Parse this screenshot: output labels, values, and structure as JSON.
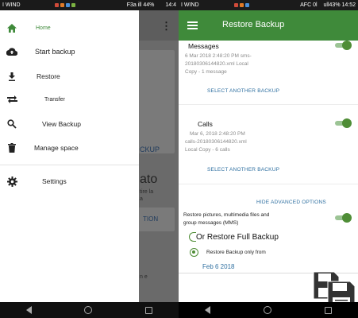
{
  "left_screen": {
    "status": {
      "left_text": "I WIND",
      "center_text": "F3a ill 44%",
      "right_text": "14:4"
    },
    "background_app": {
      "card_text_1": "CKUP",
      "big_text": "ato",
      "small_text": "tire la",
      "small_text_2": "a",
      "card_text_2": "TION",
      "bottom_text": "n e"
    },
    "drawer": {
      "items": [
        {
          "label": "Home",
          "icon": "home-icon"
        },
        {
          "label": "Start backup",
          "icon": "cloud-upload-icon"
        },
        {
          "label": "Restore",
          "icon": "download-icon"
        },
        {
          "label": "Transfer",
          "icon": "transfer-arrows-icon"
        },
        {
          "label": "View Backup",
          "icon": "search-icon"
        },
        {
          "label": "Manage space",
          "icon": "trash-icon"
        },
        {
          "label": "Settings",
          "icon": "gear-icon"
        }
      ]
    }
  },
  "right_screen": {
    "status": {
      "left_text": "I WIND",
      "right_text": "AFC 0l",
      "battery_text": "ull43% 14:52"
    },
    "appbar": {
      "title": "Restore Backup"
    },
    "messages": {
      "title": "Messages",
      "meta_line1": "6 Mar 2018 2:48:20 PM sms-",
      "meta_line2": "20180306144820.xml Local",
      "meta_line3": "Copy - 1 message",
      "link": "SELECT ANOTHER BACKUP",
      "enabled": true
    },
    "calls": {
      "title": "Calls",
      "meta_line1": "Mar 6, 2018 2:48:20 PM",
      "meta_line2": "calls-20180306144820.xml",
      "meta_line3": "Local Copy - 6 calls",
      "link": "SELECT ANOTHER BACKUP",
      "enabled": true
    },
    "advanced": {
      "hide_link": "HIDE ADVANCED OPTIONS",
      "mms_line1": "Restore pictures, multimedia files and",
      "mms_line2": "group messages (MMS)",
      "mms_enabled": true,
      "option_full": "Or Restore Full Backup",
      "option_from": "Restore Backup only from",
      "date": "Feb 6 2018"
    }
  },
  "colors": {
    "accent_green": "#3f8a3a",
    "toggle_green": "#4f8d36",
    "link_blue": "#2e6fa0"
  }
}
